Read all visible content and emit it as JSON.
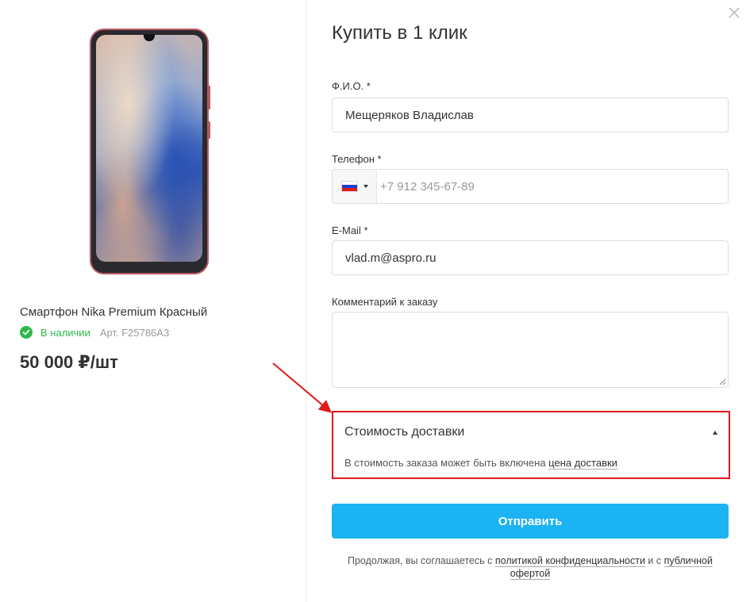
{
  "product": {
    "name": "Смартфон Nika Premium Красный",
    "stock": "В наличии",
    "article": "Арт. F25786A3",
    "price": "50 000 ₽/шт"
  },
  "form": {
    "title": "Купить в 1 клик",
    "fio_label": "Ф.И.О. *",
    "fio_value": "Мещеряков Владислав",
    "phone_label": "Телефон *",
    "phone_placeholder": "+7 912 345-67-89",
    "email_label": "E-Mail *",
    "email_value": "vlad.m@aspro.ru",
    "comment_label": "Комментарий к заказу",
    "comment_value": ""
  },
  "delivery": {
    "title": "Стоимость доставки",
    "note_prefix": "В стоимость заказа может быть включена ",
    "note_link": "цена доставки"
  },
  "submit_label": "Отправить",
  "agreement": {
    "prefix": "Продолжая, вы соглашаетесь с ",
    "privacy_link": "политикой конфиденциальности",
    "middle": " и с ",
    "offer_link_1": "публичной",
    "offer_link_2": "офертой"
  },
  "colors": {
    "accent": "#1cb3f2",
    "stock_green": "#2eb84b",
    "highlight_red": "#e01a1a"
  },
  "icons": {
    "close": "close-icon",
    "stock": "check-circle-icon",
    "country": "russia-flag-icon",
    "delivery_toggle": "caret-up-icon"
  }
}
